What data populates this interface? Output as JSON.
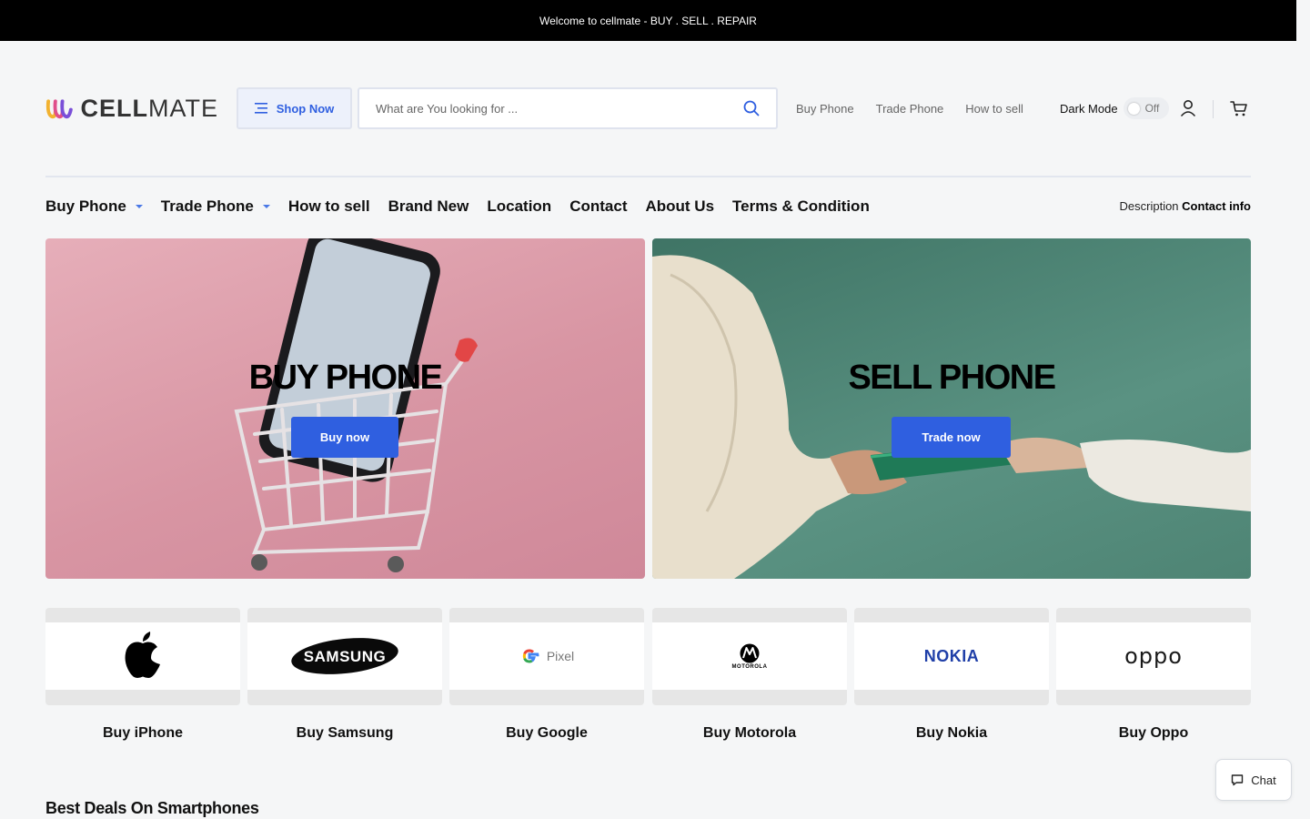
{
  "topbar": {
    "text": "Welcome to cellmate - BUY . SELL . REPAIR"
  },
  "header": {
    "logo_text_bold": "CELL",
    "logo_text_light": "MATE",
    "shop_now": "Shop Now",
    "search_placeholder": "What are You looking for ...",
    "links": [
      "Buy Phone",
      "Trade Phone",
      "How to sell"
    ],
    "dark_mode_label": "Dark Mode",
    "dark_mode_state": "Off"
  },
  "nav": {
    "items": [
      "Buy Phone",
      "Trade Phone",
      "How to sell",
      "Brand New",
      "Location",
      "Contact",
      "About Us",
      "Terms & Condition"
    ],
    "description_label": "Description",
    "contact_info": "Contact info"
  },
  "banners": {
    "buy": {
      "title": "BUY PHONE",
      "button": "Buy now"
    },
    "sell": {
      "title": "SELL PHONE",
      "button": "Trade now"
    }
  },
  "brands": [
    {
      "label": "Buy iPhone",
      "logo": "apple-logo"
    },
    {
      "label": "Buy Samsung",
      "logo": "SAMSUNG"
    },
    {
      "label": "Buy Google",
      "logo": "Pixel"
    },
    {
      "label": "Buy Motorola",
      "logo": "MOTOROLA"
    },
    {
      "label": "Buy Nokia",
      "logo": "NOKIA"
    },
    {
      "label": "Buy Oppo",
      "logo": "oppo"
    }
  ],
  "section": {
    "title": "Best Deals On Smartphones"
  },
  "chat": {
    "label": "Chat"
  },
  "colors": {
    "accent": "#2f5fe0",
    "topbar": "#000000",
    "buy_banner": "#d895a3",
    "sell_banner": "#4e8474"
  }
}
